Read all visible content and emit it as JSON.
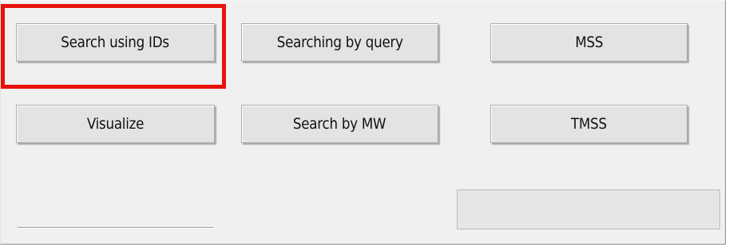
{
  "buttons": {
    "search_ids": "Search using IDs",
    "search_query": "Searching by query",
    "mss": "MSS",
    "visualize": "Visualize",
    "search_mw": "Search by MW",
    "tmss": "TMSS"
  },
  "progress": {
    "value": 0
  },
  "colors": {
    "highlight": "#e8120c",
    "window_background": "#f0f0f0",
    "button_face": "#e3e3e3"
  }
}
